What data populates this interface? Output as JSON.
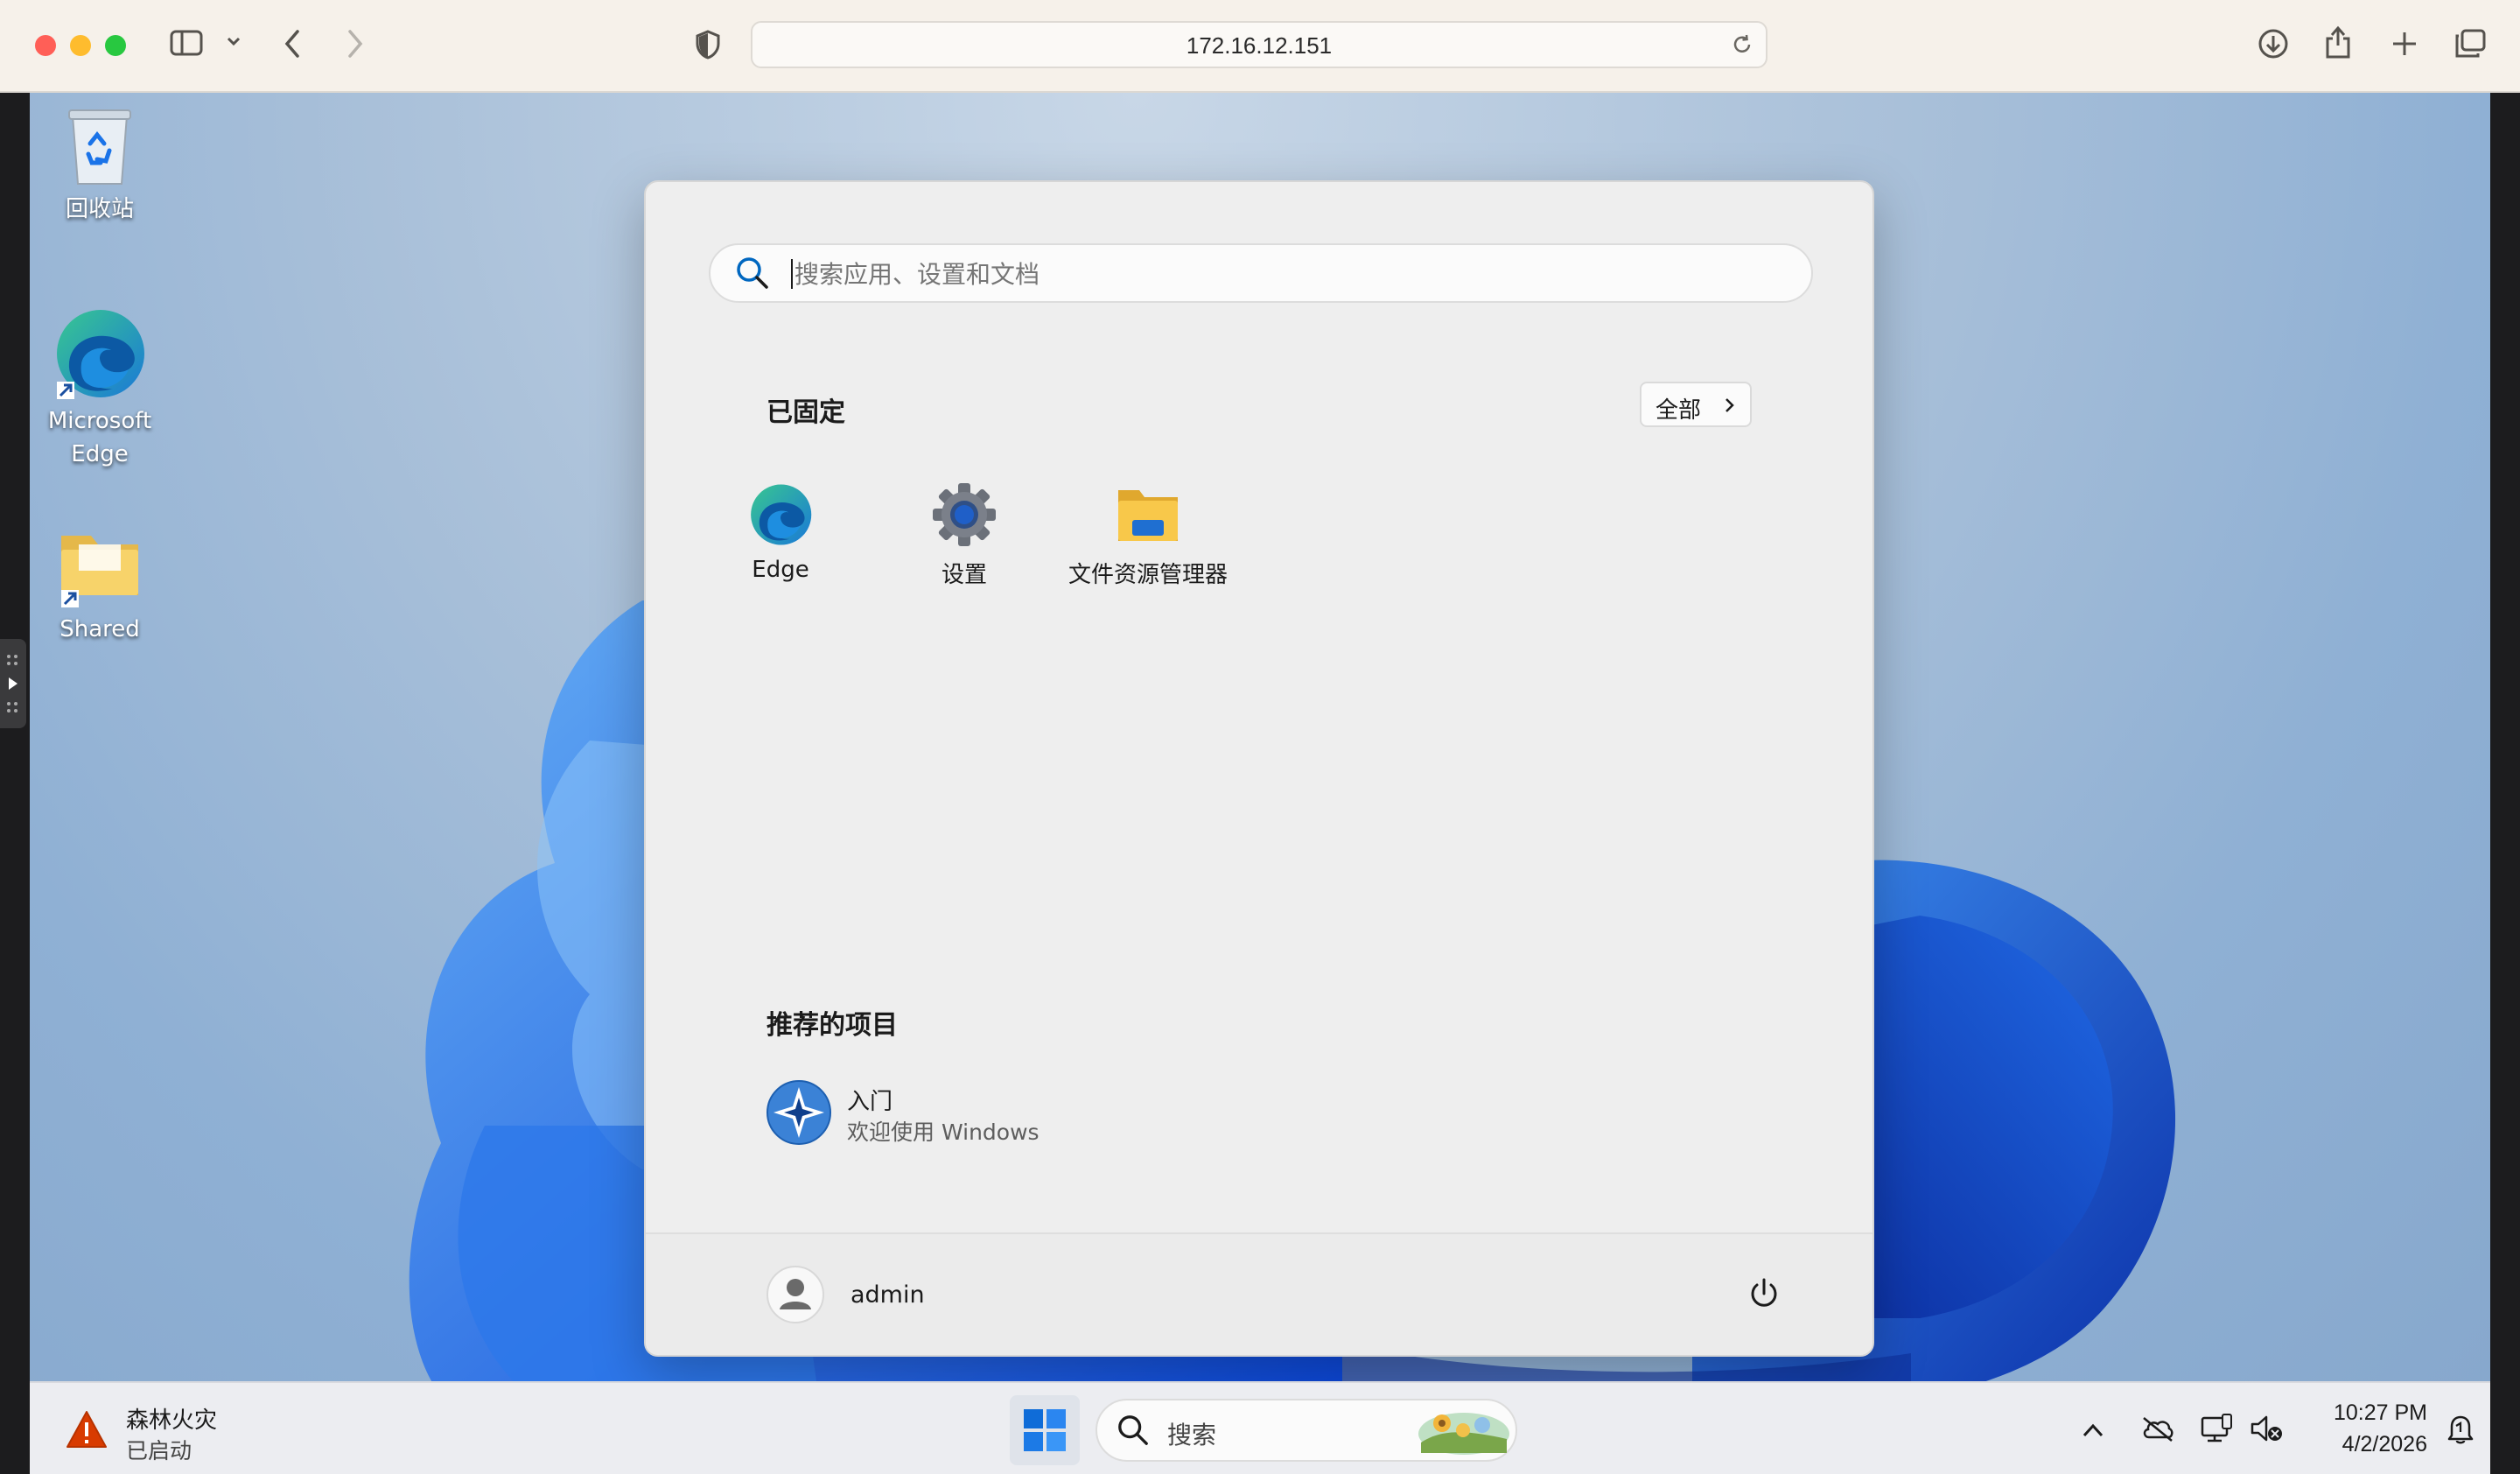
{
  "browser": {
    "url": "172.16.12.151"
  },
  "desktop": {
    "icons": [
      {
        "label": "回收站",
        "icon": "recycle-bin-icon"
      },
      {
        "label": "Microsoft Edge",
        "icon": "edge-icon"
      },
      {
        "label": "Shared",
        "icon": "folder-icon"
      }
    ]
  },
  "start_menu": {
    "search_placeholder": "搜索应用、设置和文档",
    "pinned_title": "已固定",
    "all_button_label": "全部",
    "pinned_apps": [
      {
        "label": "Edge",
        "icon": "edge-icon"
      },
      {
        "label": "设置",
        "icon": "gear-icon"
      },
      {
        "label": "文件资源管理器",
        "icon": "folder-icon"
      }
    ],
    "recommended_title": "推荐的项目",
    "recommended": [
      {
        "title": "入门",
        "subtitle": "欢迎使用 Windows",
        "icon": "get-started-icon"
      }
    ],
    "user_name": "admin"
  },
  "taskbar": {
    "weather_title": "森林火灾",
    "weather_subtitle": "已启动",
    "search_label": "搜索",
    "time": "10:27 PM",
    "date": "4/2/2026"
  },
  "colors": {
    "accent": "#0067c0",
    "warning": "#d83b01"
  }
}
